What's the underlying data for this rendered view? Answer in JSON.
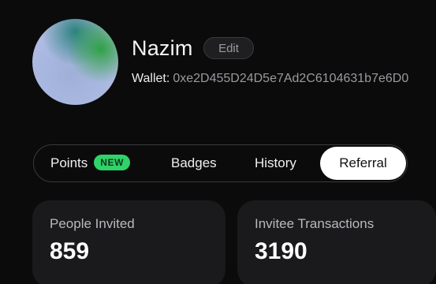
{
  "profile": {
    "name": "Nazim",
    "edit_label": "Edit",
    "wallet_label": "Wallet:",
    "wallet_address": "0xe2D455D24D5e7Ad2C6104631b7e6D0"
  },
  "tabs": [
    {
      "label": "Points",
      "badge": "NEW",
      "active": false
    },
    {
      "label": "Badges",
      "active": false
    },
    {
      "label": "History",
      "active": false
    },
    {
      "label": "Referral",
      "active": true
    }
  ],
  "stats": [
    {
      "label": "People Invited",
      "value": "859"
    },
    {
      "label": "Invitee Transactions",
      "value": "3190"
    }
  ],
  "colors": {
    "background": "#0b0b0c",
    "card": "#1a1a1c",
    "new_badge": "#2fd36a",
    "active_tab": "#ffffff"
  }
}
